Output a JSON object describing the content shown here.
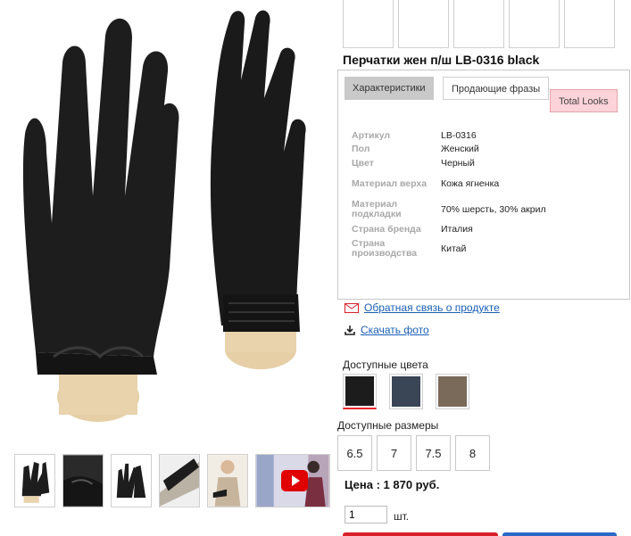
{
  "product": {
    "title": "Перчатки жен п/ш LB-0316 black",
    "price": "Цена : 1 870 руб.",
    "quantity": "1",
    "quantity_unit": "шт."
  },
  "tabs": [
    {
      "label": "Характеристики",
      "state": "inactive-grey"
    },
    {
      "label": "Продающие фразы",
      "state": "selected"
    },
    {
      "label": "Total Looks",
      "state": "pink"
    }
  ],
  "specs": [
    {
      "key": "Артикул",
      "value": "LB-0316"
    },
    {
      "key": "Пол",
      "value": "Женский"
    },
    {
      "key": "Цвет",
      "value": "Черный"
    },
    {
      "key": "Материал верха",
      "value": "Кожа ягненка"
    },
    {
      "key": "Материал подкладки",
      "value": "70% шерсть, 30% акрил"
    },
    {
      "key": "Страна бренда",
      "value": "Италия"
    },
    {
      "key": "Страна производства",
      "value": "Китай"
    }
  ],
  "links": {
    "feedback": "Обратная связь о продукте",
    "download": "Скачать фото"
  },
  "colors": {
    "label": "Доступные цвета",
    "swatches": [
      {
        "name": "black",
        "hex": "#1c1c1c",
        "selected": true
      },
      {
        "name": "navy",
        "hex": "#3a4556",
        "selected": false
      },
      {
        "name": "taupe",
        "hex": "#7a6a5a",
        "selected": false
      }
    ]
  },
  "sizes": {
    "label": "Доступные размеры",
    "items": [
      "6.5",
      "7",
      "7.5",
      "8"
    ]
  },
  "icons": {
    "feedback": "mail-icon",
    "download": "download-icon",
    "video": "play-icon"
  },
  "theme": {
    "link": "#1a5fb4",
    "accent_red": "#d8202a",
    "accent_blue": "#2b68c8",
    "tab_pink": "#fcd3d8"
  }
}
